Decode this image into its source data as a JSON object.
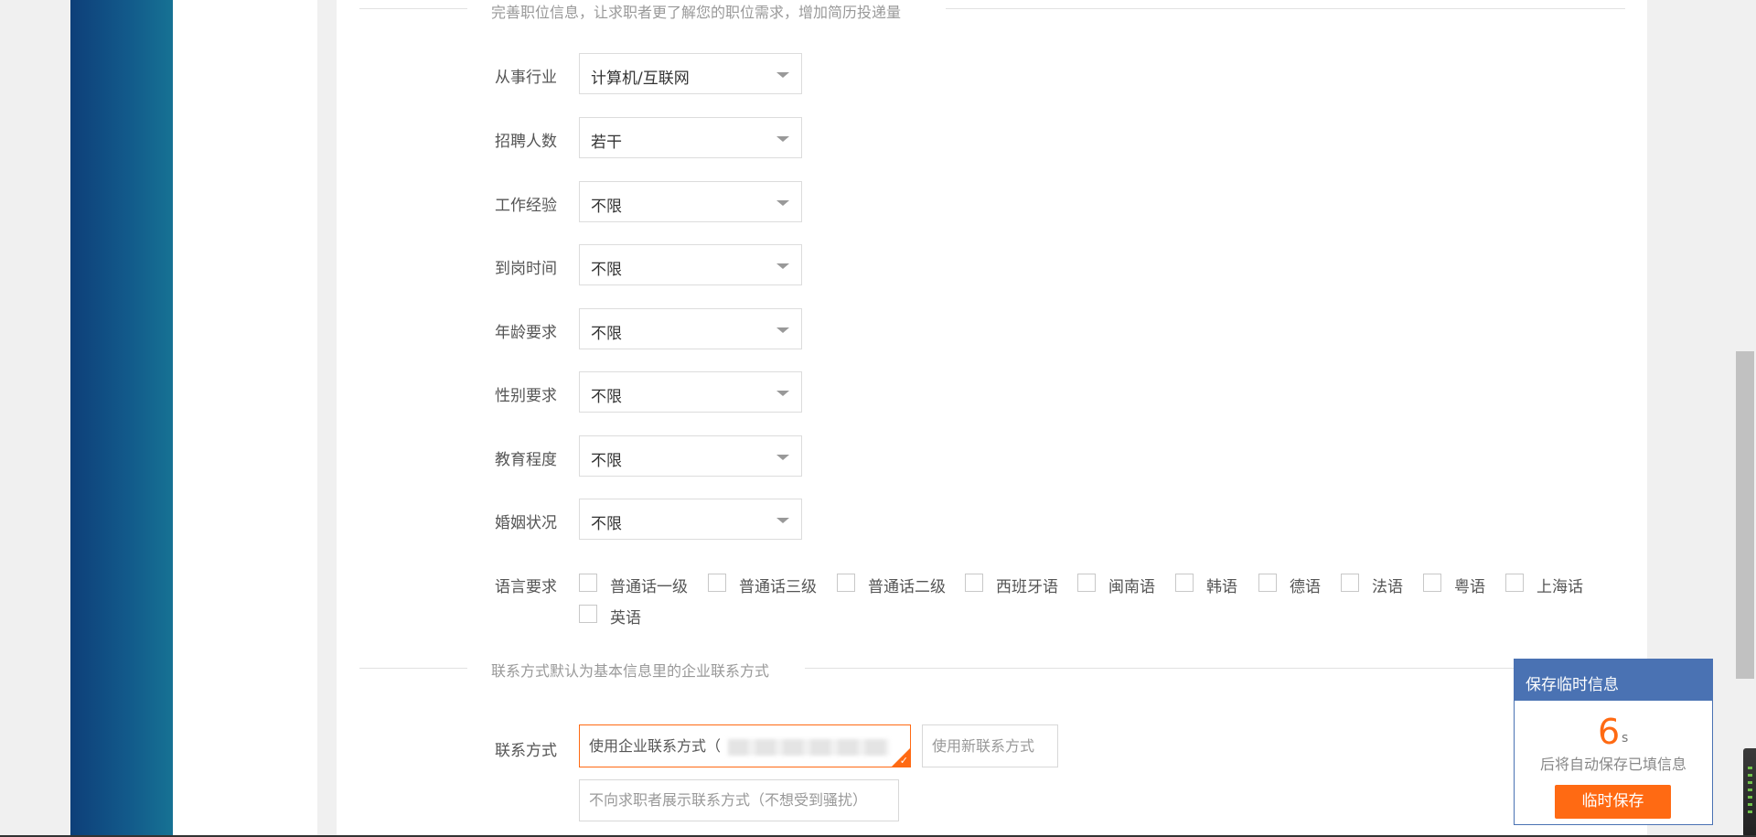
{
  "section_job_info": {
    "text": "完善职位信息，让求职者更了解您的职位需求，增加简历投递量"
  },
  "fields": [
    {
      "label": "从事行业",
      "value": "计算机/互联网"
    },
    {
      "label": "招聘人数",
      "value": "若干"
    },
    {
      "label": "工作经验",
      "value": "不限"
    },
    {
      "label": "到岗时间",
      "value": "不限"
    },
    {
      "label": "年龄要求",
      "value": "不限"
    },
    {
      "label": "性别要求",
      "value": "不限"
    },
    {
      "label": "教育程度",
      "value": "不限"
    },
    {
      "label": "婚姻状况",
      "value": "不限"
    }
  ],
  "language": {
    "label": "语言要求",
    "options": [
      "普通话一级",
      "普通话三级",
      "普通话二级",
      "西班牙语",
      "闽南语",
      "韩语",
      "德语",
      "法语",
      "粤语",
      "上海话",
      "英语"
    ]
  },
  "section_contact": {
    "text": "联系方式默认为基本信息里的企业联系方式"
  },
  "contact": {
    "label": "联系方式",
    "use_company": "使用企业联系方式（",
    "use_new": "使用新联系方式",
    "hide": "不向求职者展示联系方式（不想受到骚扰）"
  },
  "autosave": {
    "title": "保存临时信息",
    "countdown": "6",
    "unit": "s",
    "message": "后将自动保存已填信息",
    "button": "临时保存"
  },
  "colors": {
    "accent": "#ff6a13",
    "header_blue": "#4a72b3",
    "sidebar_dark": "#0e3f79"
  },
  "icons": {
    "select_caret": "caret-down-icon",
    "selected_check": "check-icon"
  }
}
